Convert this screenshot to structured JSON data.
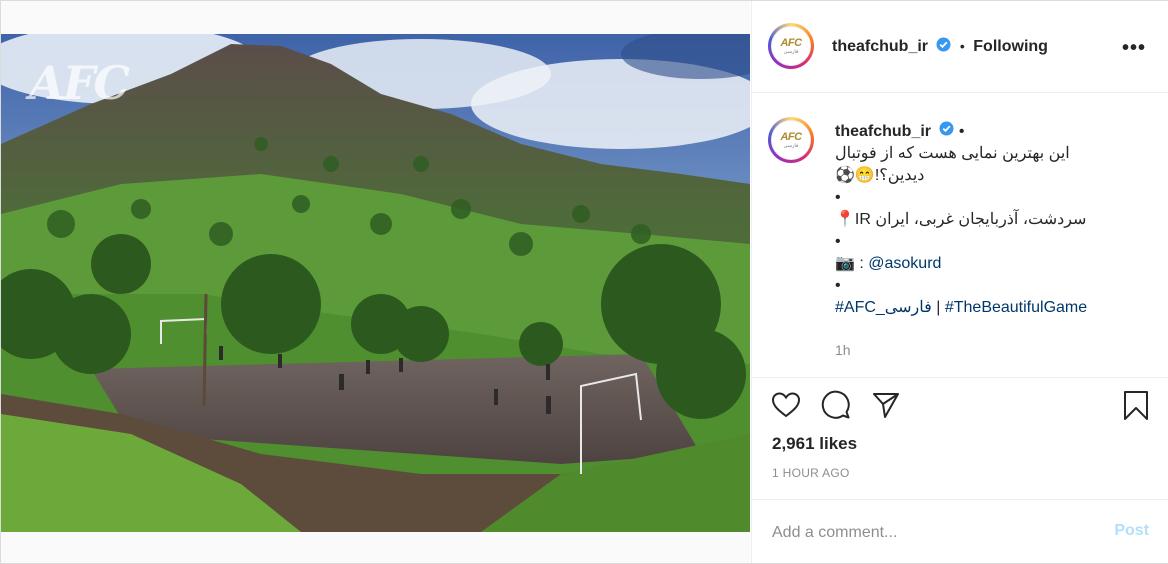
{
  "post": {
    "username": "theafchub_ir",
    "follow_status": "Following",
    "separator": "•",
    "more_icon": "more-horizontal-icon",
    "watermark": "AFC"
  },
  "avatar": {
    "logo_text": "AFC",
    "sub_text": "فارسی"
  },
  "caption": {
    "username": "theafchub_ir",
    "line1": "این بهترین نمایی هست که از فوتبال",
    "line2": "⚽😁!دیدین؟",
    "bullet": "•",
    "location_pin": "📍",
    "location": "IR سردشت، آذربایجان غربی، ایران",
    "camera": "📷",
    "credit_prefix": " : ",
    "mention": "@asokurd",
    "hashtag1": "#AFC_فارسی",
    "hashtag_separator": " | ",
    "hashtag2": "#TheBeautifulGame",
    "time_ago": "1h"
  },
  "engagement": {
    "likes": "2,961 likes",
    "posted": "1 HOUR AGO"
  },
  "comment": {
    "placeholder": "Add a comment...",
    "post_label": "Post"
  },
  "colors": {
    "link": "#00376b",
    "verified": "#3897f0",
    "post_disabled": "#b2dffc",
    "muted": "#8e8e8e"
  }
}
